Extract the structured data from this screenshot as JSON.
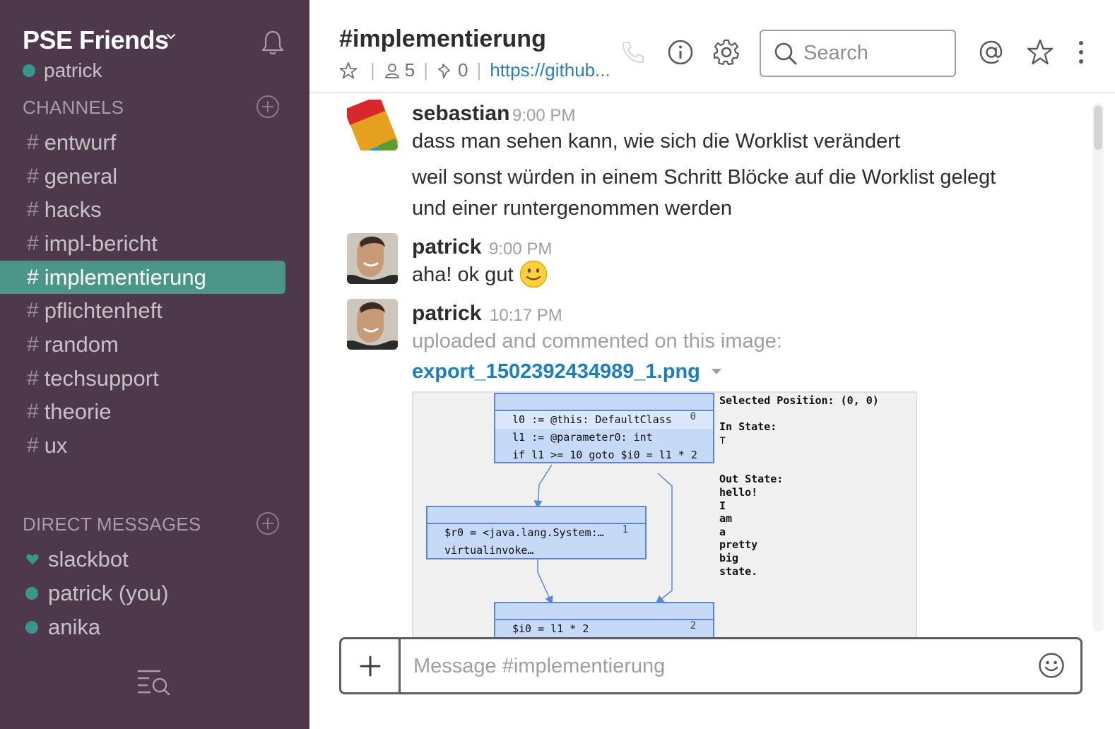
{
  "sidebar": {
    "team_name": "PSE Friends",
    "current_user": "patrick",
    "channels_header": "CHANNELS",
    "channels": [
      {
        "name": "entwurf",
        "active": false
      },
      {
        "name": "general",
        "active": false
      },
      {
        "name": "hacks",
        "active": false
      },
      {
        "name": "impl-bericht",
        "active": false
      },
      {
        "name": "implementierung",
        "active": true
      },
      {
        "name": "pflichtenheft",
        "active": false
      },
      {
        "name": "random",
        "active": false
      },
      {
        "name": "techsupport",
        "active": false
      },
      {
        "name": "theorie",
        "active": false
      },
      {
        "name": "ux",
        "active": false
      }
    ],
    "dm_header": "DIRECT MESSAGES",
    "direct_messages": [
      {
        "name": "slackbot",
        "icon": "heart-icon"
      },
      {
        "name": "patrick (you)",
        "icon": "presence-dot"
      },
      {
        "name": "anika",
        "icon": "presence-dot"
      }
    ]
  },
  "header": {
    "channel_title": "#implementierung",
    "member_count": "5",
    "pinned_count": "0",
    "topic_link": "https://github..."
  },
  "search": {
    "placeholder": "Search"
  },
  "messages": [
    {
      "author": "sebastian",
      "time": "9:00 PM",
      "lines": [
        "dass man sehen kann, wie sich die Worklist verändert",
        "weil sonst würden in einem Schritt Blöcke auf die Worklist gelegt",
        "und einer runtergenommen werden"
      ]
    },
    {
      "author": "patrick",
      "time": "9:00 PM",
      "text": "aha! ok gut"
    },
    {
      "author": "patrick",
      "time": "10:17 PM",
      "subtext": "uploaded and commented on this image:",
      "file_name": "export_1502392434989_1.png"
    }
  ],
  "attachment": {
    "blocks": [
      {
        "number": "0",
        "lines": [
          "l0 := @this: DefaultClass",
          "l1 := @parameter0: int",
          "if l1 >= 10 goto $i0 = l1 * 2"
        ]
      },
      {
        "number": "1",
        "lines": [
          "$r0 = <java.lang.System:…",
          "virtualinvoke…"
        ]
      },
      {
        "number": "2",
        "lines": [
          "$i0 = l1 * 2"
        ]
      }
    ],
    "selected_position": "Selected Position: (0, 0)",
    "in_state_label": "In State:",
    "in_state_value": "⊤",
    "out_state_label": "Out State:",
    "out_state_lines": [
      "hello!",
      "I",
      "am",
      "a",
      "pretty",
      "big",
      "state."
    ]
  },
  "composer": {
    "placeholder": "Message #implementierung"
  },
  "colors": {
    "sidebar_bg": "#4d394b",
    "active_channel": "#4c9689",
    "presence": "#38978d",
    "link": "#1d7dc1"
  }
}
